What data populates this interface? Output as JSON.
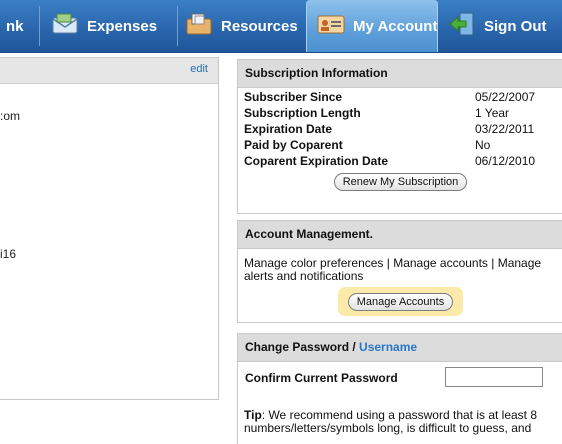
{
  "nav": {
    "partial_label": "nk",
    "expenses_label": "Expenses",
    "resources_label": "Resources",
    "myaccount_label": "My Account",
    "signout_label": "Sign Out"
  },
  "left_panel": {
    "edit_label": "edit",
    "fragment_email": ":om",
    "fragment_number": "i16"
  },
  "subscription": {
    "title": "Subscription Information",
    "rows": [
      {
        "label": "Subscriber Since",
        "value": "05/22/2007"
      },
      {
        "label": "Subscription Length",
        "value": "1 Year"
      },
      {
        "label": "Expiration Date",
        "value": "03/22/2011"
      },
      {
        "label": "Paid by Coparent",
        "value": "No"
      },
      {
        "label": "Coparent Expiration Date",
        "value": "06/12/2010"
      }
    ],
    "renew_button": "Renew My Subscription"
  },
  "account_management": {
    "title": "Account Management.",
    "description": "Manage color preferences | Manage accounts | Manage alerts and notifications",
    "manage_button": "Manage Accounts"
  },
  "change_password": {
    "title_prefix": "Change Password /",
    "title_link": "Username",
    "confirm_label": "Confirm Current Password",
    "confirm_value": "",
    "tip_label": "Tip",
    "tip_text": ": We recommend using a password that is at least 8 numbers/letters/symbols long, is difficult to guess, and"
  },
  "colors": {
    "nav_blue": "#2a66ad",
    "active_tab": "#5d9fda",
    "link_blue": "#2a78c8",
    "highlight": "#fbeaa9"
  }
}
